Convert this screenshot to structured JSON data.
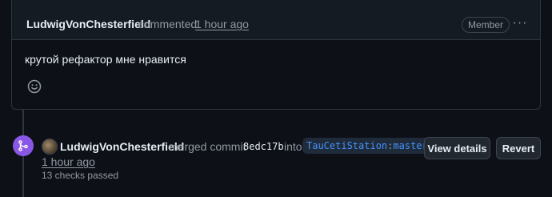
{
  "comment": {
    "author": "LudwigVonChesterfield",
    "action": "commented",
    "time": "1 hour ago",
    "badge": "Member",
    "menu_glyph": "···",
    "body": "крутой рефактор мне нравится"
  },
  "merge_event": {
    "author": "LudwigVonChesterfield",
    "action": "merged commit",
    "sha": "8edc17b",
    "into": "into",
    "repo": "TauCetiStation",
    "separator": ":",
    "branch": "master",
    "time": "1 hour ago",
    "checks": "13 checks passed",
    "view_details_label": "View details",
    "revert_label": "Revert"
  },
  "colors": {
    "background": "#0d1117",
    "header_bg": "#151b23",
    "border": "#30363d",
    "merge_purple": "#8957e5",
    "link_blue": "#4493f8"
  },
  "icons": {
    "reaction": "smiley-icon",
    "merge": "git-merge-icon",
    "menu": "kebab-horizontal-icon"
  }
}
